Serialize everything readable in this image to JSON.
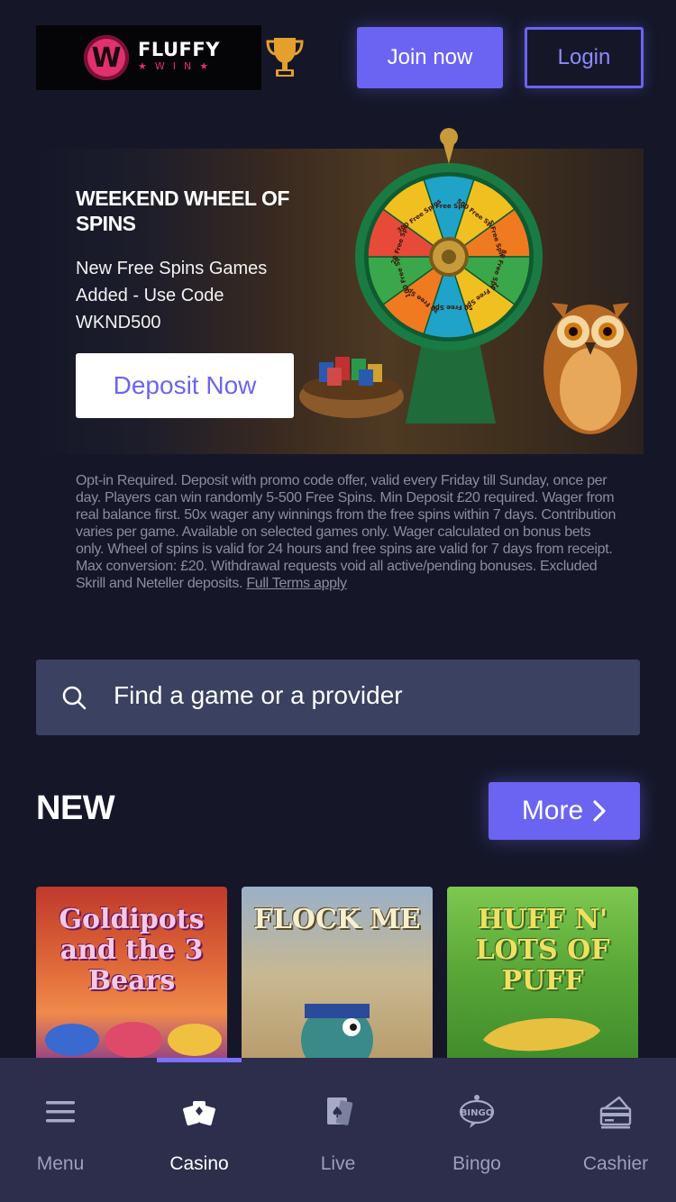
{
  "header": {
    "logo_letter": "W",
    "logo_main": "FLUFFY",
    "logo_sub": "WIN",
    "join_label": "Join now",
    "login_label": "Login"
  },
  "banner": {
    "title": "WEEKEND WHEEL OF SPINS",
    "description": "New Free Spins Games Added - Use Code WKND500",
    "cta_label": "Deposit Now",
    "wheel_segments": [
      "10 Free Spins",
      "500 Free Spins",
      "5 Free Spins",
      "80 Free Spins",
      "15 Free Spins",
      "50 Free Spins",
      "30 Free Spins",
      "100 Free Spins",
      "20 Free Spins",
      "300 Free Spins"
    ]
  },
  "terms": {
    "text": "Opt-in Required. Deposit with promo code offer, valid every Friday till Sunday, once per day. Players can win randomly 5-500 Free Spins. Min Deposit £20 required. Wager from real balance first. 50x wager any winnings from the free spins within 7 days. Contribution varies per game. Available on selected games only. Wager calculated on bonus bets only. Wheel of spins is valid for 24 hours and free spins are valid for 7 days from receipt. Max conversion: £20. Withdrawal requests void all active/pending bonuses. Excluded Skrill and Neteller deposits. ",
    "link_label": "Full Terms apply"
  },
  "search": {
    "placeholder": "Find a game or a provider"
  },
  "new_section": {
    "title": "NEW",
    "more_label": "More",
    "games": [
      {
        "name": "Goldipots and the 3 Bears"
      },
      {
        "name": "FLOCK ME"
      },
      {
        "name": "HUFF N' LOTS OF PUFF"
      }
    ]
  },
  "bottom_nav": {
    "items": [
      {
        "label": "Menu",
        "icon": "menu-icon"
      },
      {
        "label": "Casino",
        "icon": "casino-icon"
      },
      {
        "label": "Live",
        "icon": "live-cards-icon"
      },
      {
        "label": "Bingo",
        "icon": "bingo-icon"
      },
      {
        "label": "Cashier",
        "icon": "cashier-icon"
      }
    ],
    "active": "Casino"
  },
  "colors": {
    "background": "#151729",
    "accent": "#6b64f2",
    "nav_background": "#2c2e4c",
    "search_background": "#3b4160"
  }
}
